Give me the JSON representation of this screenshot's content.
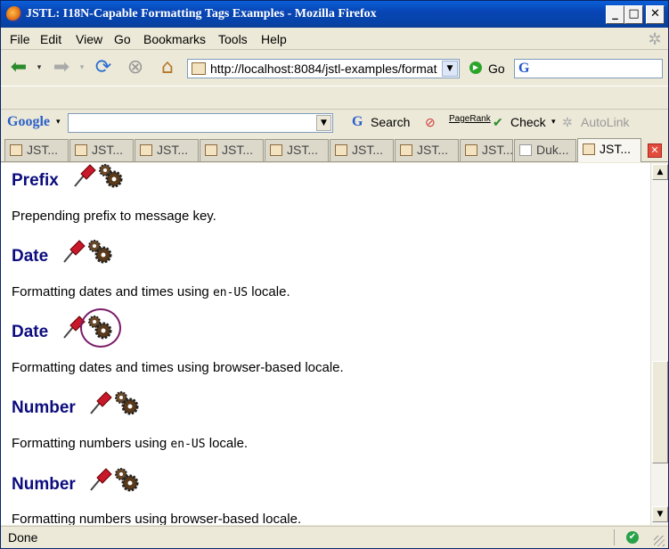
{
  "window": {
    "title": "JSTL: I18N-Capable Formatting Tags Examples - Mozilla Firefox"
  },
  "menu": [
    "File",
    "Edit",
    "View",
    "Go",
    "Bookmarks",
    "Tools",
    "Help"
  ],
  "nav": {
    "url": "http://localhost:8084/jstl-examples/format",
    "go_label": "Go"
  },
  "googlebar": {
    "logo": "Google",
    "search_label": "Search",
    "pagerank_label": "PageRank",
    "check_label": "Check",
    "autolink_label": "AutoLink"
  },
  "tabs": [
    "JST...",
    "JST...",
    "JST...",
    "JST...",
    "JST...",
    "JST...",
    "JST...",
    "JST...",
    "Duk...",
    "JST..."
  ],
  "content": {
    "sections": [
      {
        "title": "Prefix",
        "desc": "Prepending prefix to message key.",
        "code": ""
      },
      {
        "title": "Date",
        "desc_before": "Formatting dates and times using ",
        "code": "en-US",
        "desc_after": " locale."
      },
      {
        "title": "Date",
        "desc": "Formatting dates and times using browser-based locale.",
        "code": ""
      },
      {
        "title": "Number",
        "desc_before": "Formatting numbers using ",
        "code": "en-US",
        "desc_after": " locale."
      },
      {
        "title": "Number",
        "desc": "Formatting numbers using browser-based locale.",
        "code": ""
      }
    ]
  },
  "status": {
    "text": "Done"
  },
  "colors": {
    "heading": "#0c0c7e",
    "titlebar": "#0845b5",
    "annotation": "#7a1e6a"
  },
  "icons": {
    "section_icons": [
      "pushpin-icon",
      "gears-icon"
    ]
  }
}
